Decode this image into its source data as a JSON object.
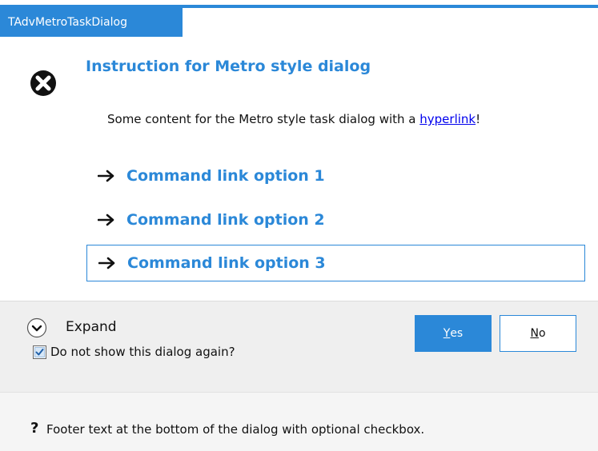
{
  "dialog": {
    "title": "TAdvMetroTaskDialog",
    "main_icon": "error-icon",
    "instruction": "Instruction for Metro style dialog",
    "content": {
      "text_before": "Some content for the Metro style task dialog with a ",
      "link": "hyperlink",
      "text_after": "!"
    },
    "command_links": [
      {
        "icon": "arrow-right-icon",
        "label": "Command link option 1",
        "focused": false
      },
      {
        "icon": "arrow-right-icon",
        "label": "Command link option 2",
        "focused": false
      },
      {
        "icon": "arrow-right-icon",
        "label": "Command link option 3",
        "focused": true
      }
    ]
  },
  "button_bar": {
    "expand_icon": "chevron-down-circle-icon",
    "expand_label": "Expand",
    "verification": {
      "label": "Do not show this dialog again?",
      "checked": true
    },
    "buttons": [
      {
        "accel": "Y",
        "rest": "es",
        "default": true
      },
      {
        "accel": "N",
        "rest": "o",
        "default": false
      }
    ]
  },
  "footer": {
    "icon_glyph": "?",
    "text": "Footer text at the bottom of the dialog with optional checkbox."
  },
  "colors": {
    "accent": "#2b88d8",
    "link": "#0000ee",
    "button_bar_bg": "#efefef",
    "footer_bg": "#f5f5f5"
  }
}
